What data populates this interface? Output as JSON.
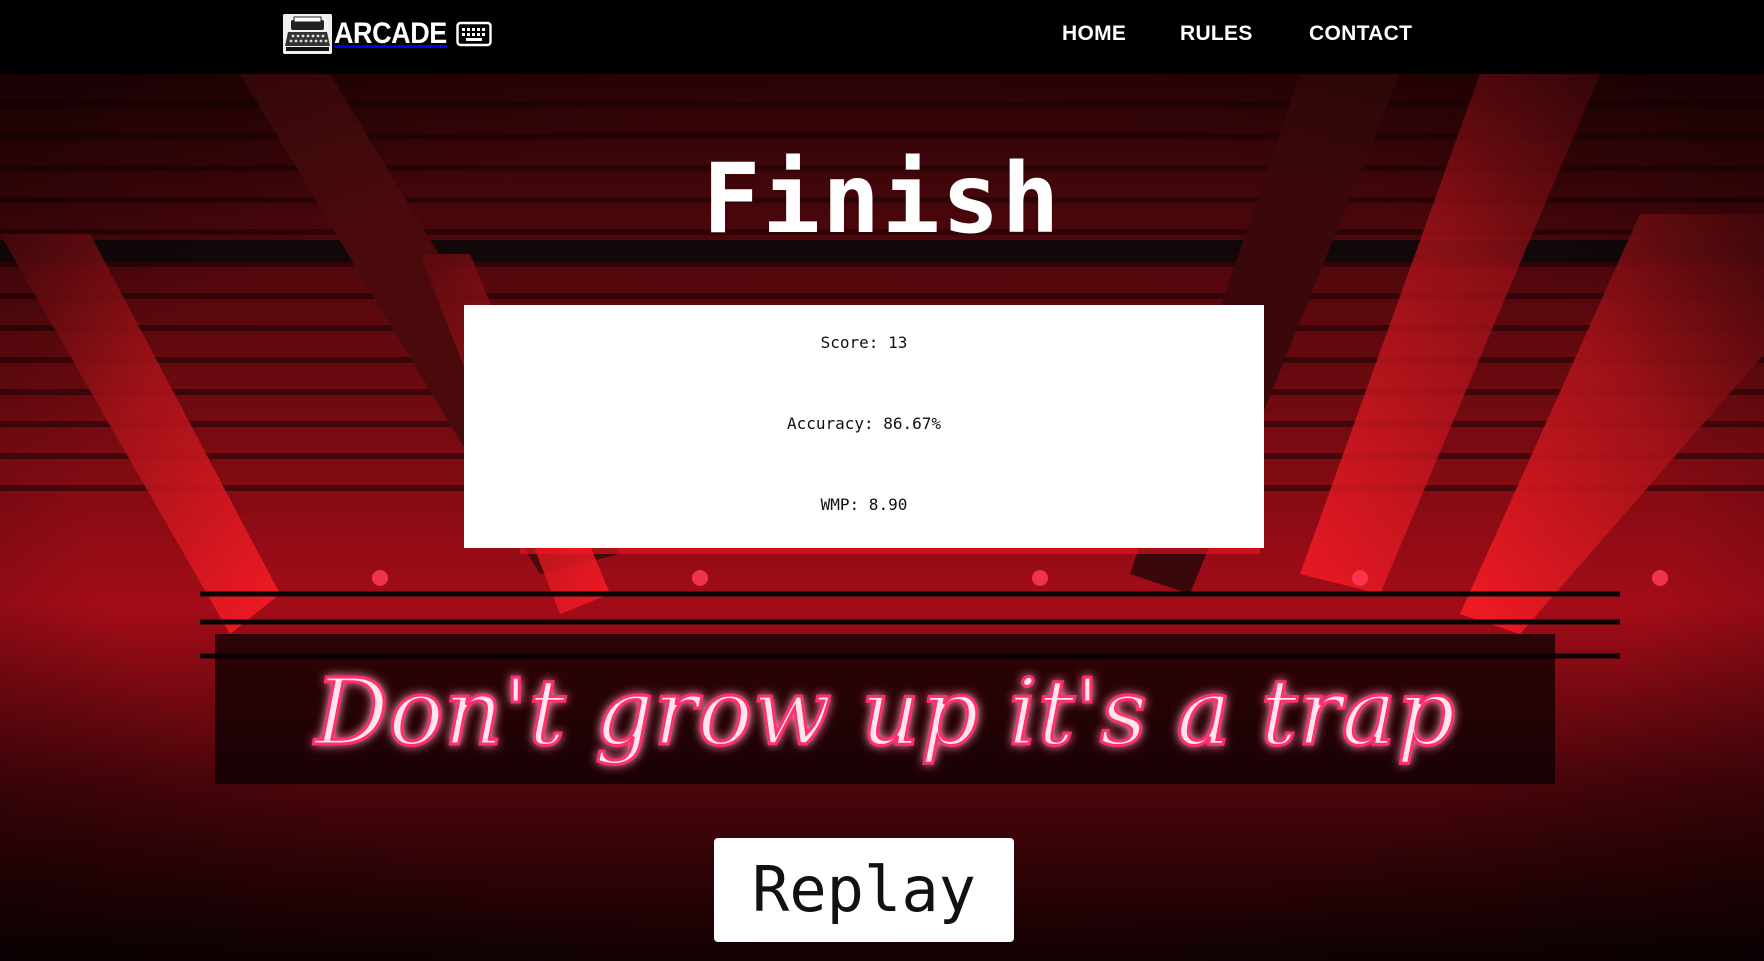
{
  "nav": {
    "brand": "ARCADE",
    "brand_logo_icon": "typewriter-icon",
    "brand_keyboard_icon": "keyboard-icon",
    "links": [
      {
        "label": "HOME"
      },
      {
        "label": "RULES"
      },
      {
        "label": "CONTACT"
      }
    ]
  },
  "hero": {
    "neon_sign": "Don't grow up it's a trap"
  },
  "result": {
    "title": "Finish",
    "score": "Score: 13",
    "accuracy": "Accuracy: 86.67%",
    "wpm": "WMP: 8.90",
    "replay_label": "Replay"
  },
  "colors": {
    "navbar_bg": "#000000",
    "neon_pink": "#ff2d6f",
    "ceiling_red": "#d40a18",
    "card_bg": "#ffffff"
  }
}
